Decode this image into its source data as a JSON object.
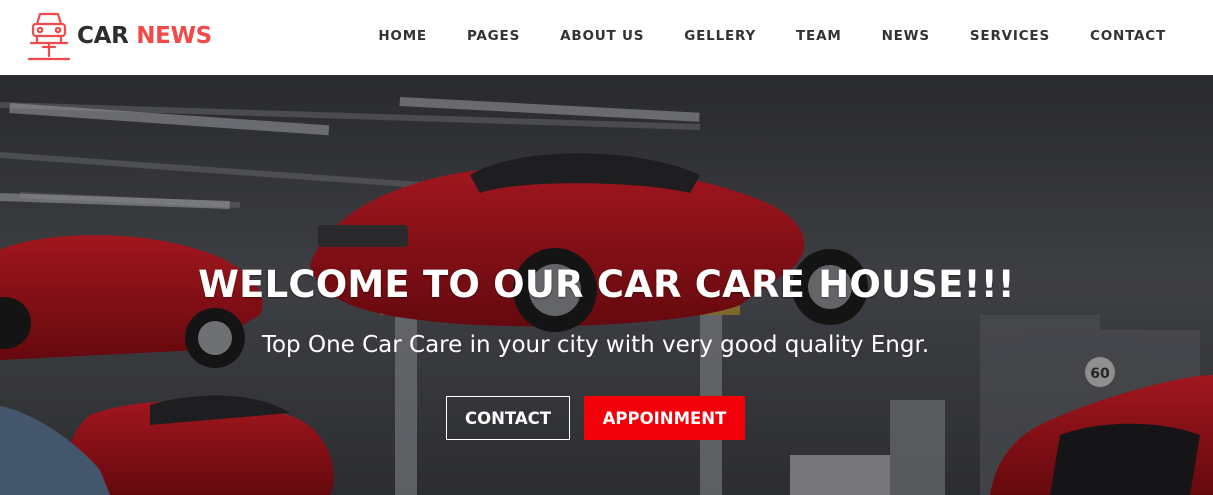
{
  "brand": {
    "word1": "CAR",
    "word2": "NEWS",
    "accent_color": "#f24a4a",
    "icon": "car-lift-icon"
  },
  "nav": {
    "items": [
      "HOME",
      "PAGES",
      "ABOUT US",
      "GELLERY",
      "TEAM",
      "NEWS",
      "SERVICES",
      "CONTACT"
    ]
  },
  "hero": {
    "title": "WELCOME TO OUR CAR CARE HOUSE!!!",
    "subtitle": "Top One Car Care in your city with very good quality Engr.",
    "contact_label": "CONTACT",
    "appointment_label": "APPOINMENT",
    "appointment_color": "#f2000a",
    "background": "car-garage-photo",
    "sign_text": "60"
  }
}
